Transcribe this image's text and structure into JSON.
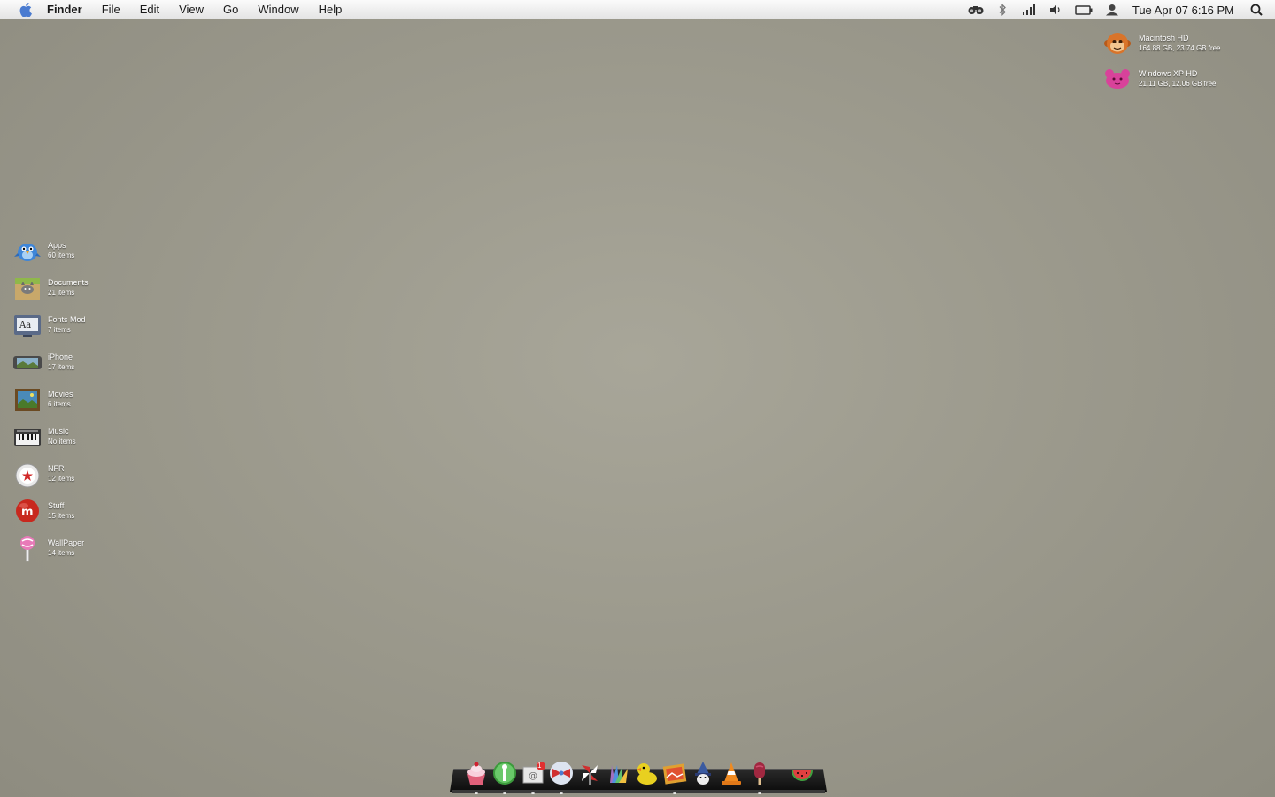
{
  "menubar": {
    "apple_icon": "apple-icon",
    "app_name": "Finder",
    "menus": [
      "File",
      "Edit",
      "View",
      "Go",
      "Window",
      "Help"
    ],
    "status_icons": [
      "binoculars-icon",
      "bluetooth-icon",
      "signal-bars-icon",
      "volume-icon",
      "battery-icon",
      "user-icon"
    ],
    "clock": "Tue Apr 07 6:16 PM",
    "spotlight_icon": "spotlight-search-icon"
  },
  "drives": [
    {
      "name": "Macintosh HD",
      "info": "164.88 GB, 23.74 GB free",
      "icon": "monkey-drive-icon",
      "color": "#d9742a"
    },
    {
      "name": "Windows XP HD",
      "info": "21.11 GB, 12.06 GB free",
      "icon": "pink-creature-drive-icon",
      "color": "#d8429a"
    }
  ],
  "folders": [
    {
      "name": "Apps",
      "info": "60 items",
      "icon": "blue-bird-icon",
      "color": "#3f86d8"
    },
    {
      "name": "Documents",
      "info": "21 items",
      "icon": "cat-box-icon",
      "color": "#9aa04a"
    },
    {
      "name": "Fonts Mod",
      "info": "7 items",
      "icon": "fonts-display-icon",
      "color": "#5a6a88"
    },
    {
      "name": "iPhone",
      "info": "17 items",
      "icon": "iphone-icon",
      "color": "#4a4a4a"
    },
    {
      "name": "Movies",
      "info": "6 items",
      "icon": "movie-frame-icon",
      "color": "#6b4a22"
    },
    {
      "name": "Music",
      "info": "No items",
      "icon": "keyboard-music-icon",
      "color": "#dcdcdc"
    },
    {
      "name": "NFR",
      "info": "12 items",
      "icon": "nfr-badge-icon",
      "color": "#e8e8e8"
    },
    {
      "name": "Stuff",
      "info": "15 items",
      "icon": "m-ball-icon",
      "color": "#c8281e"
    },
    {
      "name": "WallPaper",
      "info": "14 items",
      "icon": "lollipop-icon",
      "color": "#e87ab8"
    }
  ],
  "dock": {
    "items": [
      {
        "icon": "cupcake-icon",
        "color": "#e0607a"
      },
      {
        "icon": "green-globe-icon",
        "color": "#3c9a3c"
      },
      {
        "icon": "mail-stamp-icon",
        "color": "#e8e8e8",
        "badge": "1"
      },
      {
        "icon": "bowtie-icon",
        "color": "#4a7ad0"
      },
      {
        "icon": "pinwheel-icon",
        "color": "#d03030"
      },
      {
        "icon": "color-fan-icon",
        "color": "#a070c0"
      },
      {
        "icon": "duck-icon",
        "color": "#e8d020"
      },
      {
        "icon": "photo-film-icon",
        "color": "#e0a030"
      },
      {
        "icon": "wizard-icon",
        "color": "#3a5aa0"
      },
      {
        "icon": "traffic-cone-icon",
        "color": "#f08a20"
      },
      {
        "icon": "popsicle-icon",
        "color": "#a02840"
      },
      {
        "icon": "watermelon-icon",
        "color": "#40a040"
      }
    ]
  }
}
